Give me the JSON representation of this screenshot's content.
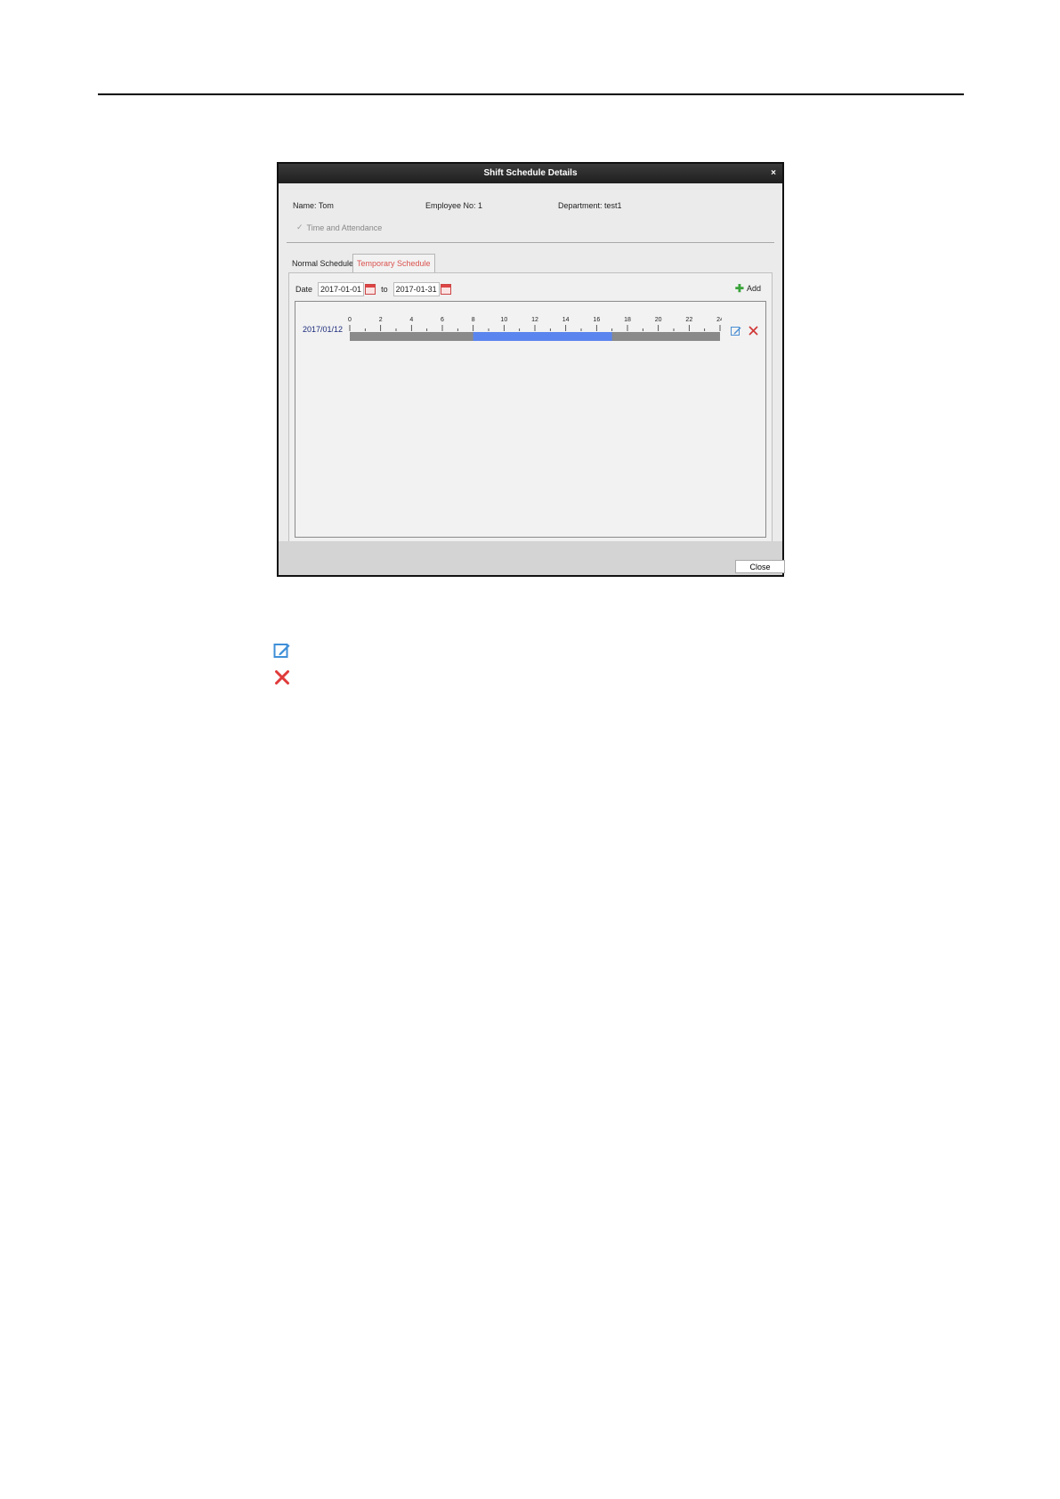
{
  "dialog": {
    "title": "Shift Schedule Details",
    "close_symbol": "×",
    "name": "Name: Tom",
    "employee_no": "Employee No: 1",
    "department": "Department: test1",
    "checkbox_label": "Time and Attendance",
    "tabs": {
      "normal": "Normal Schedule",
      "temporary": "Temporary Schedule"
    },
    "date_label": "Date",
    "date_from": "2017-01-01",
    "to_label": "to",
    "date_to": "2017-01-31",
    "add_label": "Add",
    "close_button": "Close",
    "timeline": {
      "ticks": [
        "0",
        "2",
        "4",
        "6",
        "8",
        "10",
        "12",
        "14",
        "16",
        "18",
        "20",
        "22",
        "24"
      ],
      "rows": [
        {
          "date": "2017/01/12",
          "shift_start_hour": 8,
          "shift_end_hour": 17
        }
      ]
    },
    "colors": {
      "shift": "#5b85ee",
      "track": "#8a8a8a",
      "accent_tab": "#d9534f"
    }
  },
  "legend": [
    {
      "icon": "edit-icon"
    },
    {
      "icon": "delete-icon"
    }
  ]
}
